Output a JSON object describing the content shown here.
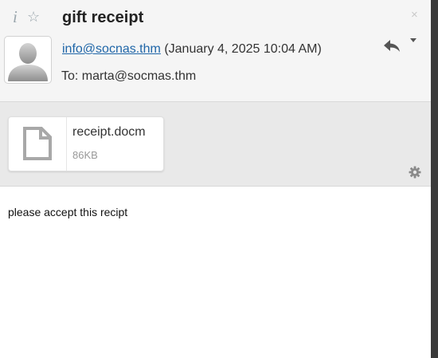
{
  "header": {
    "subject": "gift receipt",
    "from_email": "info@socnas.thm",
    "date": "(January 4, 2025 10:04 AM)",
    "to_line": "To: marta@socmas.thm",
    "icons": {
      "info": "info-icon",
      "star": "star-outline-icon",
      "close": "close-icon",
      "reply": "reply-icon",
      "more": "chevron-down-icon",
      "avatar": "default-user-avatar"
    }
  },
  "attachments": [
    {
      "name": "receipt.docm",
      "size": "86KB",
      "icon": "document-icon"
    }
  ],
  "attachment_settings_icon": "gear-icon",
  "body": {
    "text": "please accept this recipt"
  },
  "colors": {
    "link": "#1f66a8",
    "header_bg": "#f5f5f5",
    "attachment_bg": "#e9e9e9",
    "rail": "#3a3a3a"
  }
}
